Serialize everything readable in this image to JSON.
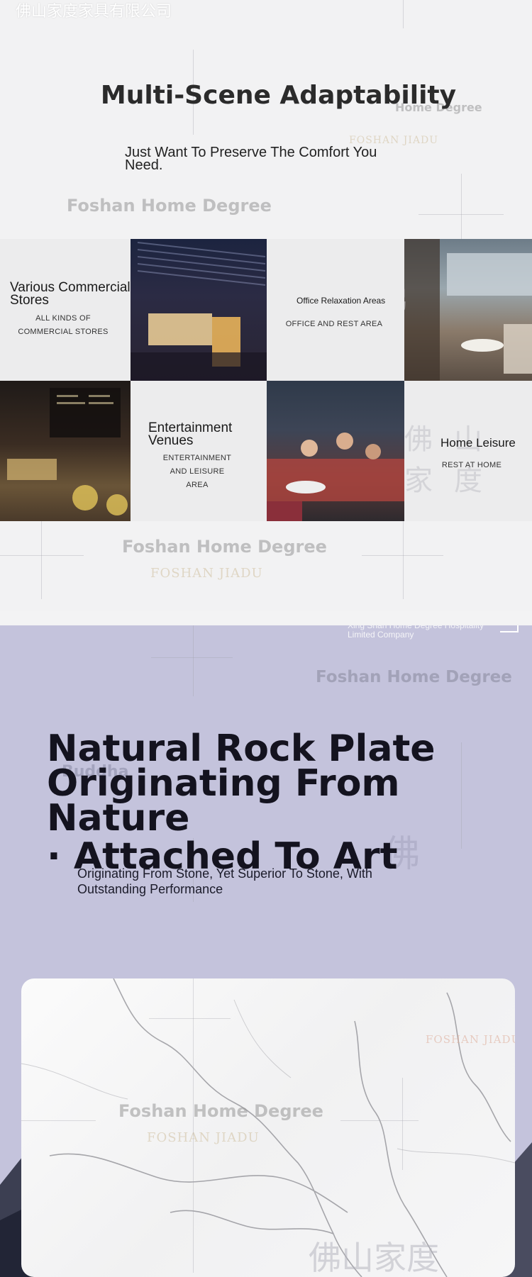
{
  "header": {
    "company_cn": "佛山家度家具有限公司",
    "title": "Multi-Scene Adaptability",
    "subtitle": "Just Want To Preserve The Comfort You Need."
  },
  "watermarks": {
    "brand": "Foshan Home Degree",
    "brand_sub": "FOSHAN JIADU",
    "home_degree": "Home Degree",
    "cn_char": "佛",
    "cn_brand": "佛山家度",
    "buddha": "Buddha",
    "company_en": "Xing Shan Home Degree Hospitality Limited Company"
  },
  "scenes": [
    {
      "heading": "Various Commercial Stores",
      "caption": "ALL KINDS OF COMMERCIAL STORES"
    },
    {
      "heading": "Office Relaxation Areas",
      "caption": "OFFICE AND REST AREA"
    },
    {
      "heading": "Entertainment Venues",
      "caption": "ENTERTAINMENT AND LEISURE AREA"
    },
    {
      "heading": "Home Leisure",
      "caption": "REST AT HOME"
    }
  ],
  "section2": {
    "title_line1": "Natural Rock Plate",
    "title_line2": "Originating From Nature",
    "title_line3": "· Attached To Art",
    "subtitle": "Originating From Stone, Yet Superior To Stone, With Outstanding Performance"
  },
  "colors": {
    "section1_bg": "#f2f2f3",
    "section2_bg": "#c4c3dc",
    "title_dark": "#14131f"
  }
}
